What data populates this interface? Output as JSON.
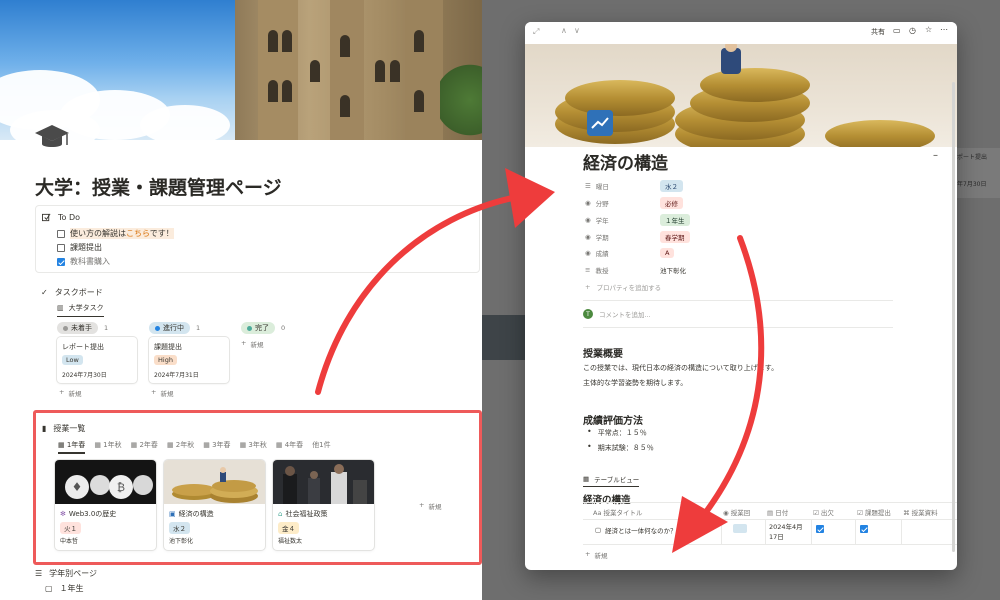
{
  "left": {
    "title": "大学：授業・課題管理ページ",
    "todo": {
      "heading": "To Do",
      "items": [
        {
          "pre": "使い方の解説は",
          "link": "こちら",
          "post": "です！",
          "checked": false
        },
        {
          "text": "課題提出",
          "checked": false
        },
        {
          "text": "教科書購入",
          "checked": true
        }
      ]
    },
    "taskboard": {
      "heading": "タスクボード",
      "view": "大学タスク",
      "columns": [
        {
          "label": "未着手",
          "count": "1",
          "color": "#9b9a97",
          "bg": "#e3e2e0"
        },
        {
          "label": "進行中",
          "count": "1",
          "color": "#2383e2",
          "bg": "#d3e5ef"
        },
        {
          "label": "完了",
          "count": "0",
          "color": "#4dab9a",
          "bg": "#dbeddb"
        }
      ],
      "cards": [
        {
          "title": "レポート提出",
          "tag": "Low",
          "tag_bg": "#d3e5ef",
          "date": "2024年7月30日"
        },
        {
          "title": "課題提出",
          "tag": "High",
          "tag_bg": "#fadec9",
          "date": "2024年7月31日"
        }
      ],
      "new_label": "新規"
    },
    "courses": {
      "heading": "授業一覧",
      "tabs": [
        "1年春",
        "1年秋",
        "2年春",
        "2年秋",
        "3年春",
        "3年秋",
        "4年春",
        "他1件"
      ],
      "cards": [
        {
          "title": "Web3.0の歴史",
          "tag": "火１",
          "tag_bg": "#ffe2dd",
          "prof": "中本哲"
        },
        {
          "title": "経済の構造",
          "tag": "水２",
          "tag_bg": "#d3e5ef",
          "prof": "池下彰化"
        },
        {
          "title": "社会福祉政策",
          "tag": "金４",
          "tag_bg": "#fdecc8",
          "prof": "福祉数太"
        }
      ],
      "new_label": "新規"
    },
    "bottom": {
      "heading": "学年別ページ",
      "item": "１年生"
    }
  },
  "modal": {
    "topbar": {
      "share": "共有"
    },
    "title": "経済の構造",
    "properties": [
      {
        "key": "曜日",
        "value": "水２",
        "bg": "#d3e5ef",
        "color": "#28456c"
      },
      {
        "key": "分野",
        "value": "必修",
        "bg": "#ffe2dd",
        "color": "#5d1715"
      },
      {
        "key": "学年",
        "value": "１年生",
        "bg": "#dbeddb",
        "color": "#1c3829"
      },
      {
        "key": "学期",
        "value": "春学期",
        "bg": "#ffe2dd",
        "color": "#5d1715"
      },
      {
        "key": "成績",
        "value": "A",
        "bg": "#ffe2dd",
        "color": "#5d1715"
      },
      {
        "key": "教授",
        "value": "池下彰化",
        "bg": "",
        "color": "#37352f"
      }
    ],
    "add_property": "プロパティを追加する",
    "comment_placeholder": "コメントを追加...",
    "overview_heading": "授業概要",
    "overview_lines": [
      "この授業では、現代日本の経済の構造について取り上げます。",
      "主体的な学習姿勢を期待します。"
    ],
    "grading_heading": "成績評価方法",
    "grading_items": [
      "平常点：１５％",
      "期末試験：８５％"
    ],
    "table_view_label": "テーブルビュー",
    "table_title": "経済の構造",
    "table_headers": [
      "授業タイトル",
      "授業回",
      "日付",
      "出欠",
      "課題提出",
      "授業資料"
    ],
    "table_row": {
      "title": "経済とは一体何なのか？",
      "date_l1": "2024年4月",
      "date_l2": "17日"
    },
    "new_label": "新規"
  },
  "peek": {
    "line1": "ポート提出",
    "line2": "年7月30日"
  }
}
